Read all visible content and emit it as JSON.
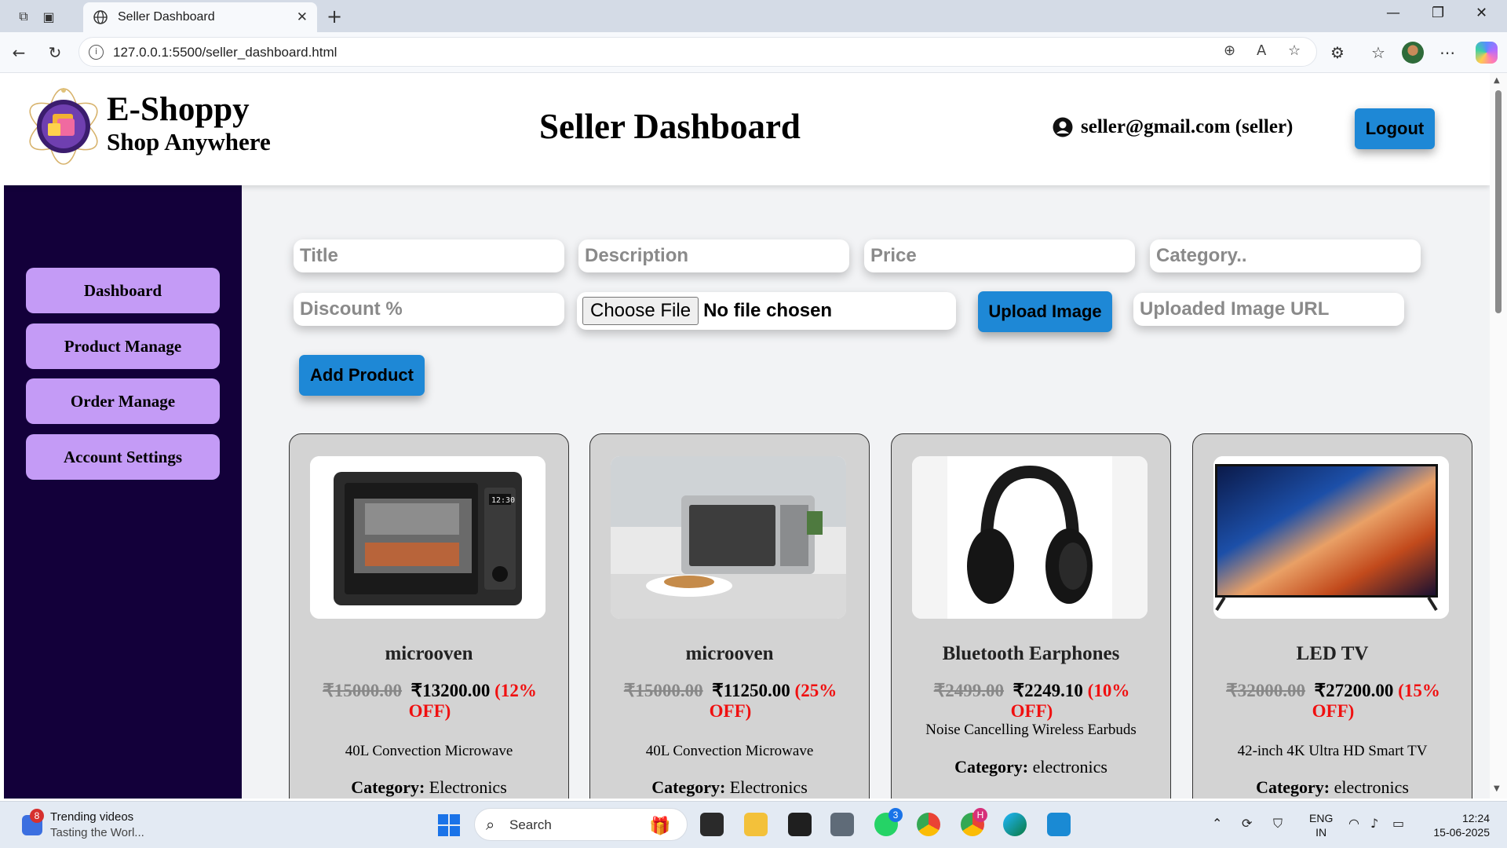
{
  "browser": {
    "tab_title": "Seller Dashboard",
    "url": "127.0.0.1:5500/seller_dashboard.html"
  },
  "header": {
    "brand_name": "E-Shoppy",
    "brand_tagline": "Shop Anywhere",
    "page_title": "Seller Dashboard",
    "user_label": "seller@gmail.com (seller)",
    "logout_label": "Logout"
  },
  "sidebar": {
    "items": [
      {
        "label": "Dashboard"
      },
      {
        "label": "Product Manage"
      },
      {
        "label": "Order Manage"
      },
      {
        "label": "Account Settings"
      }
    ]
  },
  "form": {
    "title_placeholder": "Title",
    "description_placeholder": "Description",
    "price_placeholder": "Price",
    "category_placeholder": "Category..",
    "discount_placeholder": "Discount %",
    "choose_file_label": "Choose File",
    "no_file_label": "No file chosen",
    "upload_label": "Upload Image",
    "uploaded_url_placeholder": "Uploaded Image URL",
    "add_label": "Add Product"
  },
  "products": [
    {
      "name": "microoven",
      "old_price": "₹15000.00",
      "price": "₹13200.00",
      "off": "(12% OFF)",
      "desc": "40L Convection Microwave",
      "category_label": "Category:",
      "category": "Electronics"
    },
    {
      "name": "microoven",
      "old_price": "₹15000.00",
      "price": "₹11250.00",
      "off": "(25% OFF)",
      "desc": "40L Convection Microwave",
      "category_label": "Category:",
      "category": "Electronics"
    },
    {
      "name": "Bluetooth Earphones",
      "old_price": "₹2499.00",
      "price": "₹2249.10",
      "off": "(10% OFF)",
      "desc": "Noise Cancelling Wireless Earbuds",
      "category_label": "Category:",
      "category": "electronics"
    },
    {
      "name": "LED TV",
      "old_price": "₹32000.00",
      "price": "₹27200.00",
      "off": "(15% OFF)",
      "desc": "42-inch 4K Ultra HD Smart TV",
      "category_label": "Category:",
      "category": "electronics"
    }
  ],
  "taskbar": {
    "news_badge": "8",
    "news_title": "Trending videos",
    "news_sub": "Tasting the Worl...",
    "search_label": "Search",
    "whatsapp_badge": "3",
    "chrome_badge": "H",
    "lang_top": "ENG",
    "lang_bottom": "IN",
    "time": "12:24",
    "date": "15-06-2025"
  },
  "colors": {
    "sidebar_bg": "#13003a",
    "sidebar_button": "#c49bf6",
    "primary_button": "#1e88d6",
    "discount_text": "#f01010",
    "card_bg": "#d3d3d3"
  }
}
